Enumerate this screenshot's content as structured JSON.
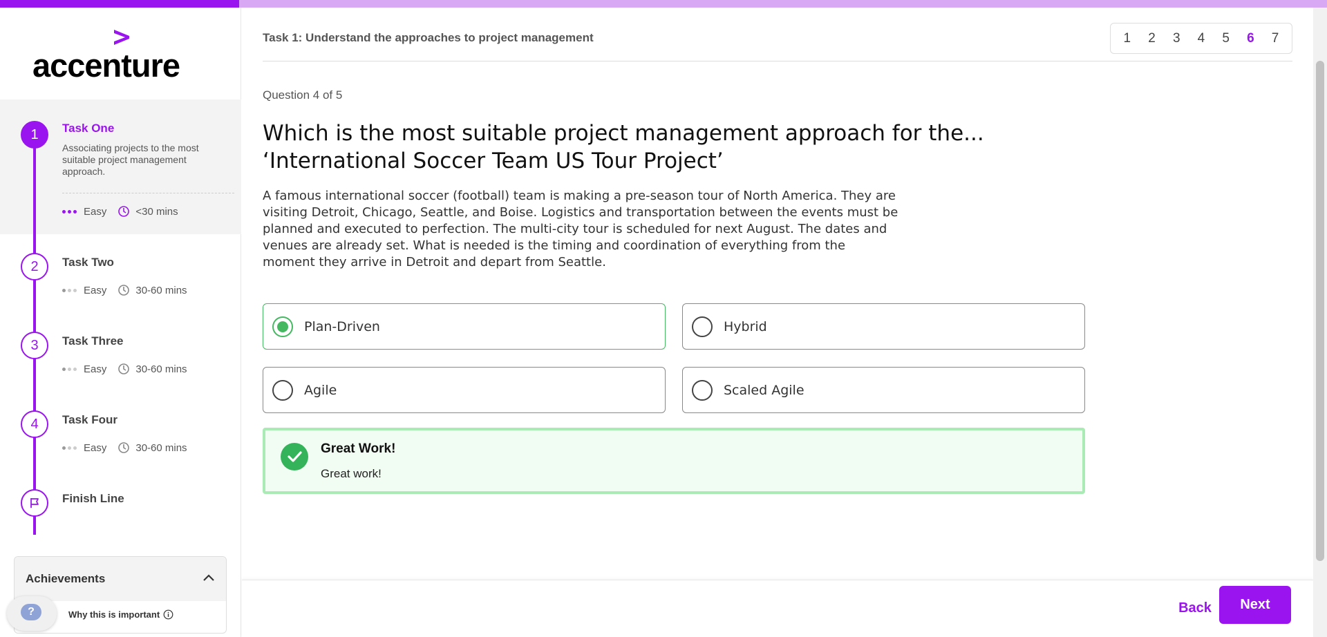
{
  "colors": {
    "accent": "#9a14ef",
    "success": "#46b862",
    "success_bg": "#f1fcf2"
  },
  "progress": {
    "fraction": 0.18
  },
  "brand": {
    "logo_text": "accenture"
  },
  "sidebar": {
    "tasks": [
      {
        "number": "1",
        "title": "Task One",
        "description": "Associating projects to the most suitable project management approach.",
        "difficulty": "Easy",
        "duration": "<30 mins",
        "active": true
      },
      {
        "number": "2",
        "title": "Task Two",
        "difficulty": "Easy",
        "duration": "30-60 mins"
      },
      {
        "number": "3",
        "title": "Task Three",
        "difficulty": "Easy",
        "duration": "30-60 mins"
      },
      {
        "number": "4",
        "title": "Task Four",
        "difficulty": "Easy",
        "duration": "30-60 mins"
      }
    ],
    "finish": {
      "title": "Finish Line",
      "icon": "flag-icon"
    },
    "achievements": {
      "label": "Achievements",
      "why_label": "Why this is important"
    },
    "help": {
      "label": "?"
    }
  },
  "header": {
    "task_title": "Task 1: Understand the approaches to project management",
    "pages": [
      "1",
      "2",
      "3",
      "4",
      "5",
      "6",
      "7"
    ],
    "current_page": "6"
  },
  "question": {
    "counter": "Question 4 of 5",
    "title": "Which is the most suitable project management approach for the... ‘International Soccer Team US Tour Project’",
    "body": "A famous international soccer (football) team is making a pre-season tour of North America. They are visiting Detroit, Chicago, Seattle, and Boise. Logistics and transportation between the events must be planned and executed to perfection. The multi-city tour is scheduled for next August. The dates and venues are already set. What is needed is the timing and coordination of everything from the moment they arrive in Detroit and depart from Seattle.",
    "options": [
      {
        "label": "Plan-Driven",
        "selected": true
      },
      {
        "label": "Hybrid",
        "selected": false
      },
      {
        "label": "Agile",
        "selected": false
      },
      {
        "label": "Scaled Agile",
        "selected": false
      }
    ]
  },
  "feedback": {
    "title": "Great Work!",
    "body": "Great work!"
  },
  "footer": {
    "back_label": "Back",
    "next_label": "Next"
  }
}
